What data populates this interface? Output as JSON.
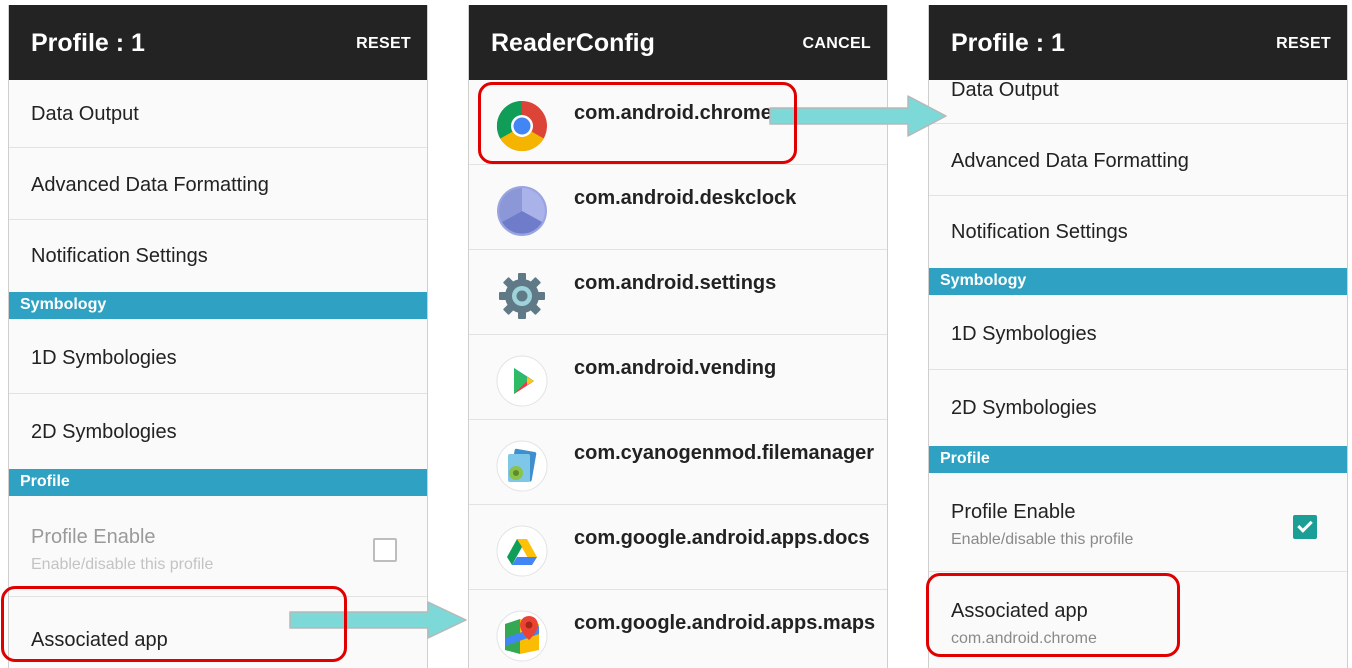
{
  "screen1": {
    "title": "Profile : 1",
    "action": "RESET",
    "items": [
      "Data Output",
      "Advanced Data Formatting",
      "Notification Settings"
    ],
    "cat_symbology": "Symbology",
    "sym_items": [
      "1D Symbologies",
      "2D Symbologies"
    ],
    "cat_profile": "Profile",
    "profile_enable": {
      "label": "Profile Enable",
      "summary": "Enable/disable this profile",
      "checked": false,
      "enabled": false
    },
    "associated_app": {
      "label": "Associated app"
    }
  },
  "screen2": {
    "title": "ReaderConfig",
    "action": "CANCEL",
    "apps": [
      {
        "package": "com.android.chrome",
        "icon": "chrome-icon"
      },
      {
        "package": "com.android.deskclock",
        "icon": "deskclock-icon"
      },
      {
        "package": "com.android.settings",
        "icon": "settings-gear-icon"
      },
      {
        "package": "com.android.vending",
        "icon": "play-store-icon"
      },
      {
        "package": "com.cyanogenmod.filemanager",
        "icon": "file-manager-icon"
      },
      {
        "package": "com.google.android.apps.docs",
        "icon": "google-drive-icon"
      },
      {
        "package": "com.google.android.apps.maps",
        "icon": "google-maps-icon"
      }
    ]
  },
  "screen3": {
    "title": "Profile : 1",
    "action": "RESET",
    "items": [
      "Data Output",
      "Advanced Data Formatting",
      "Notification Settings"
    ],
    "cat_symbology": "Symbology",
    "sym_items": [
      "1D Symbologies",
      "2D Symbologies"
    ],
    "cat_profile": "Profile",
    "profile_enable": {
      "label": "Profile Enable",
      "summary": "Enable/disable this profile",
      "checked": true,
      "enabled": true
    },
    "associated_app": {
      "label": "Associated app",
      "summary": "com.android.chrome"
    }
  },
  "colors": {
    "appbar": "#232323",
    "category": "#2fa2c4",
    "checkbox_checked": "#1b9e95",
    "highlight": "#e00000",
    "arrow": "#7dd8d8"
  }
}
